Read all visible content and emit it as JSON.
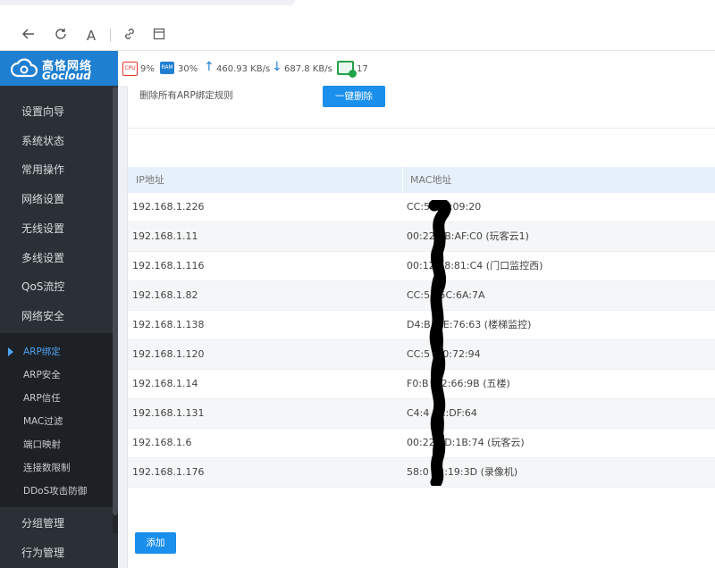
{
  "browser": {
    "icons": [
      "back-arrow-icon",
      "reload-icon",
      "reader-mode-icon",
      "link-icon",
      "sidebar-icon"
    ],
    "reader_glyph": "A"
  },
  "brand": {
    "name_cn": "高恪网络",
    "name_en": "Gocloud"
  },
  "status": {
    "cpu_chip": "CPU",
    "cpu": "9%",
    "ram_chip": "RAM",
    "ram": "30%",
    "upload": "460.93 KB/s",
    "download": "687.8 KB/s",
    "connections": "17"
  },
  "sidebar": {
    "items": [
      {
        "label": "设置向导"
      },
      {
        "label": "系统状态"
      },
      {
        "label": "常用操作"
      },
      {
        "label": "网络设置"
      },
      {
        "label": "无线设置"
      },
      {
        "label": "多线设置"
      },
      {
        "label": "QoS流控"
      },
      {
        "label": "网络安全"
      }
    ],
    "subitems": [
      {
        "label": "ARP绑定",
        "active": true
      },
      {
        "label": "ARP安全"
      },
      {
        "label": "ARP信任"
      },
      {
        "label": "MAC过滤"
      },
      {
        "label": "端口映射"
      },
      {
        "label": "连接数限制"
      },
      {
        "label": "DDoS攻击防御"
      }
    ],
    "bottom_items": [
      {
        "label": "分组管理"
      },
      {
        "label": "行为管理"
      }
    ]
  },
  "main": {
    "delete_all_label": "删除所有ARP绑定规则",
    "delete_all_button": "一键删除",
    "add_button": "添加",
    "table": {
      "columns": [
        "IP地址",
        "MAC地址"
      ],
      "rows": [
        {
          "ip": "192.168.1.226",
          "mac": "CC:5      :2B:09:20"
        },
        {
          "ip": "192.168.1.11",
          "mac": "00:22      4B:AF:C0 (玩客云1)"
        },
        {
          "ip": "192.168.1.116",
          "mac": "00:12      18:81:C4 (门口监控西)"
        },
        {
          "ip": "192.168.1.82",
          "mac": "CC:50      5C:6A:7A"
        },
        {
          "ip": "192.168.1.138",
          "mac": "D4:B      :4E:76:63 (楼梯监控)"
        },
        {
          "ip": "192.168.1.120",
          "mac": "CC:5      :20:72:94"
        },
        {
          "ip": "192.168.1.14",
          "mac": "F0:B      :12:66:9B (五楼)"
        },
        {
          "ip": "192.168.1.131",
          "mac": "C4:4      8C:DF:64"
        },
        {
          "ip": "192.168.1.6",
          "mac": "00:22      2D:1B:74 (玩客云)"
        },
        {
          "ip": "192.168.1.176",
          "mac": "58:0      02:19:3D (录像机)"
        }
      ]
    }
  },
  "colors": {
    "sidebar_bg": "#2b3036",
    "brand_blue": "#1f7fd1",
    "button_blue": "#1a8fec",
    "active_sub": "#4fa3f0",
    "table_header_bg": "#e6f0fa"
  }
}
